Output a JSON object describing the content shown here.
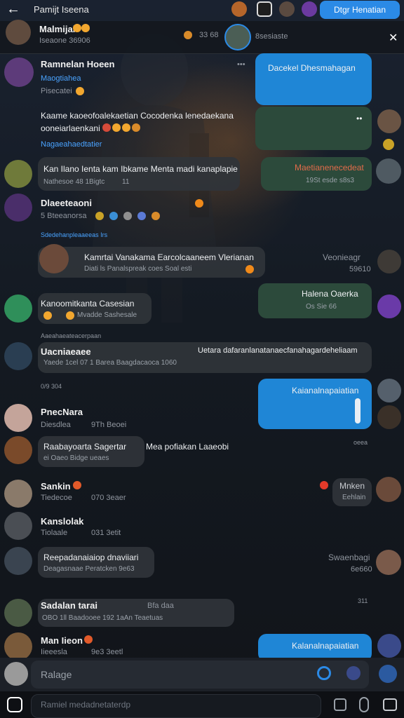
{
  "colors": {
    "accent": "#2b8ae6",
    "outgoing": "#1f86d6",
    "outgoing_green": "#2c4a3b",
    "incoming": "#30343a"
  },
  "header": {
    "title": "Pamijt Iseena",
    "join_label": "Dtgr Henatian"
  },
  "pinned": {
    "name": "Malmijai",
    "meta": "Iseaone 36906",
    "count": "33 68",
    "tag": "8sesiaste"
  },
  "messages": {
    "m1": {
      "name": "Ramnelan Hoeen",
      "link": "Maogtiahea",
      "meta": "Pisecatei"
    },
    "m1b": {
      "text": "Dacekel Dhesmahagan"
    },
    "m2": {
      "text": "Kaame kaoeofoalekaetian Cocodenka lenedaekana",
      "text2": "ooneiarlaenkani",
      "link": "Nagaeahaedtatier"
    },
    "m2b": {
      "text": "••"
    },
    "m3": {
      "text": "Kan Ilano Ienta kam Ibkame Menta madi kanaplapie",
      "meta": "Nathesoe 48  1Bigtc",
      "meta2": "11"
    },
    "m3b": {
      "text": "Maetianenecedeat",
      "meta": "19St esde s8s3"
    },
    "m4": {
      "name": "Dlaeeteaoni",
      "meta": "5 Bteeanorsa"
    },
    "m4_sep": {
      "text": "Sdedehanpleaaeeas   Irs"
    },
    "m5": {
      "text": "Kamrtai Vanakama Earcolcaaneem Vlerianan",
      "meta": "Diati  ls  Panalspreak  coes  Soal esti"
    },
    "m5_side": {
      "text": "Veonieagr",
      "meta": "59610"
    },
    "m5b": {
      "text": "Halena Oaerka",
      "meta": "Os  Sie  66"
    },
    "m6": {
      "text": "Kanoomitkanta Casesian",
      "meta": "Mvadde Sashesale"
    },
    "m6_sep": {
      "text": "Aaeahaeateacerpaan"
    },
    "m7": {
      "name": "Uacniaeaee",
      "text": "Uetara dafaranlanatanaecfanahagardeheliaam",
      "meta": "Yaede  1cel  07 1  Barea   Baagdacaoca   1060"
    },
    "m7_sep": {
      "text": "0/9   304"
    },
    "m8": {
      "text": "Kaianalnapaiatian"
    },
    "m9": {
      "name": "PnecNara",
      "meta": "Diesdlea",
      "meta2": "9Th Beoei"
    },
    "m9_side": {
      "text": "oeea"
    },
    "m10": {
      "text": "Raabayoarta Sagertar",
      "text2": "Mea pofiakan Laaeobi",
      "meta": "ei Oaeo  Bidge ueaes"
    },
    "m11": {
      "name": "Sankin",
      "meta": "Tiedecoe",
      "meta2": "070 3eaer"
    },
    "m11_side": {
      "text": "Mnken",
      "meta": "Eehlain"
    },
    "m12": {
      "name": "Kanslolak",
      "meta": "Tiolaale",
      "meta2": "031 3etit"
    },
    "m13": {
      "text": "Reepadanaiaiop dnaviiari",
      "meta": "Deagasnaae  Peratcken 9e63"
    },
    "m13_side": {
      "text": "Swaenbagi",
      "meta": "6e660"
    },
    "m14": {
      "name": "Sadalan tarai",
      "tag": "Bfa daa",
      "meta": "OBO  1ll  Baadooee  192  1aAn  Teaetuas",
      "meta2": "311"
    },
    "m15": {
      "name": "Man Iieon",
      "meta": "Iieeesla",
      "meta2": "9e3 3eetl"
    },
    "m15b": {
      "text": "Kalanalnapaiatian"
    }
  },
  "composer": {
    "placeholder": "Ralage",
    "placeholder2": "Ramiel medadnetaterdp"
  }
}
